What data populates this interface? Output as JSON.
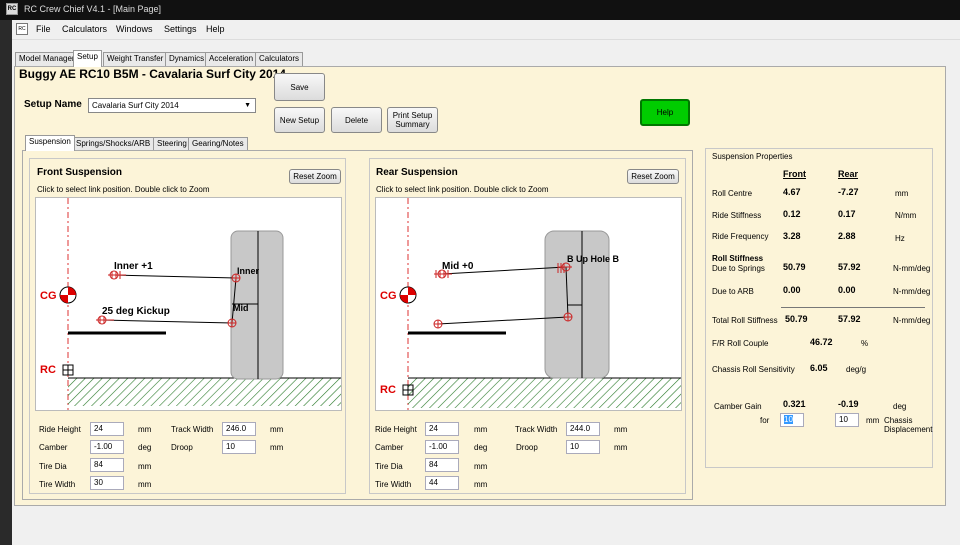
{
  "app": {
    "title": "RC Crew Chief V4.1 - [Main Page]",
    "icon": "app-logo-icon"
  },
  "menu": {
    "items": [
      "File",
      "Calculators",
      "Windows",
      "Settings",
      "Help"
    ]
  },
  "main_tabs": [
    "Model Manager",
    "Setup",
    "Weight Transfer",
    "Dynamics",
    "Acceleration",
    "Calculators"
  ],
  "page_title": "Buggy AE RC10 B5M - Cavalaria Surf City 2014",
  "setup": {
    "label": "Setup Name",
    "value": "Cavalaria Surf City 2014",
    "save": "Save",
    "new": "New Setup",
    "delete": "Delete",
    "print": "Print Setup Summary",
    "help": "Help"
  },
  "sub_tabs": [
    "Suspension",
    "Springs/Shocks/ARB",
    "Steering",
    "Gearing/Notes"
  ],
  "front": {
    "title": "Front Suspension",
    "hint": "Click to select link position. Double click to Zoom",
    "reset": "Reset Zoom",
    "labels": {
      "cg": "CG",
      "rc": "RC",
      "inner": "Inner +1",
      "kickup": "25 deg Kickup",
      "outer_top": "Inner",
      "outer_mid": "Mid"
    },
    "fields": {
      "ride_height": {
        "label": "Ride Height",
        "value": "24",
        "unit": "mm"
      },
      "camber": {
        "label": "Camber",
        "value": "-1.00",
        "unit": "deg"
      },
      "tire_dia": {
        "label": "Tire Dia",
        "value": "84",
        "unit": "mm"
      },
      "tire_width": {
        "label": "Tire Width",
        "value": "30",
        "unit": "mm"
      },
      "track_width": {
        "label": "Track Width",
        "value": "246.0",
        "unit": "mm"
      },
      "droop": {
        "label": "Droop",
        "value": "10",
        "unit": "mm"
      }
    }
  },
  "rear": {
    "title": "Rear Suspension",
    "hint": "Click to select link position. Double click to Zoom",
    "reset": "Reset Zoom",
    "labels": {
      "cg": "CG",
      "rc": "RC",
      "inner": "Mid +0",
      "outer_top": "B Up Hole B"
    },
    "fields": {
      "ride_height": {
        "label": "Ride Height",
        "value": "24",
        "unit": "mm"
      },
      "camber": {
        "label": "Camber",
        "value": "-1.00",
        "unit": "deg"
      },
      "tire_dia": {
        "label": "Tire Dia",
        "value": "84",
        "unit": "mm"
      },
      "tire_width": {
        "label": "Tire Width",
        "value": "44",
        "unit": "mm"
      },
      "track_width": {
        "label": "Track Width",
        "value": "244.0",
        "unit": "mm"
      },
      "droop": {
        "label": "Droop",
        "value": "10",
        "unit": "mm"
      }
    }
  },
  "props": {
    "title": "Suspension Properties",
    "front_hdr": "Front",
    "rear_hdr": "Rear",
    "roll_centre": {
      "label": "Roll Centre",
      "front": "4.67",
      "rear": "-7.27",
      "unit": "mm"
    },
    "ride_stiffness": {
      "label": "Ride Stiffness",
      "front": "0.12",
      "rear": "0.17",
      "unit": "N/mm"
    },
    "ride_frequency": {
      "label": "Ride Frequency",
      "front": "3.28",
      "rear": "2.88",
      "unit": "Hz"
    },
    "roll_stiffness_hdr": "Roll Stiffness",
    "due_springs": {
      "label": "Due to Springs",
      "front": "50.79",
      "rear": "57.92",
      "unit": "N-mm/deg"
    },
    "due_arb": {
      "label": "Due to ARB",
      "front": "0.00",
      "rear": "0.00",
      "unit": "N-mm/deg"
    },
    "total_roll": {
      "label": "Total Roll Stiffness",
      "front": "50.79",
      "rear": "57.92",
      "unit": "N-mm/deg"
    },
    "fr_couple": {
      "label": "F/R Roll Couple",
      "value": "46.72",
      "unit": "%"
    },
    "chassis_roll": {
      "label": "Chassis Roll Sensitivity",
      "value": "6.05",
      "unit": "deg/g"
    },
    "camber_gain": {
      "label": "Camber Gain",
      "front": "0.321",
      "rear": "-0.19",
      "unit": "deg"
    },
    "for_label": "for",
    "disp_front": "10",
    "disp_rear": "10",
    "disp_unit": "mm",
    "disp_label": "Chassis Displacement"
  }
}
